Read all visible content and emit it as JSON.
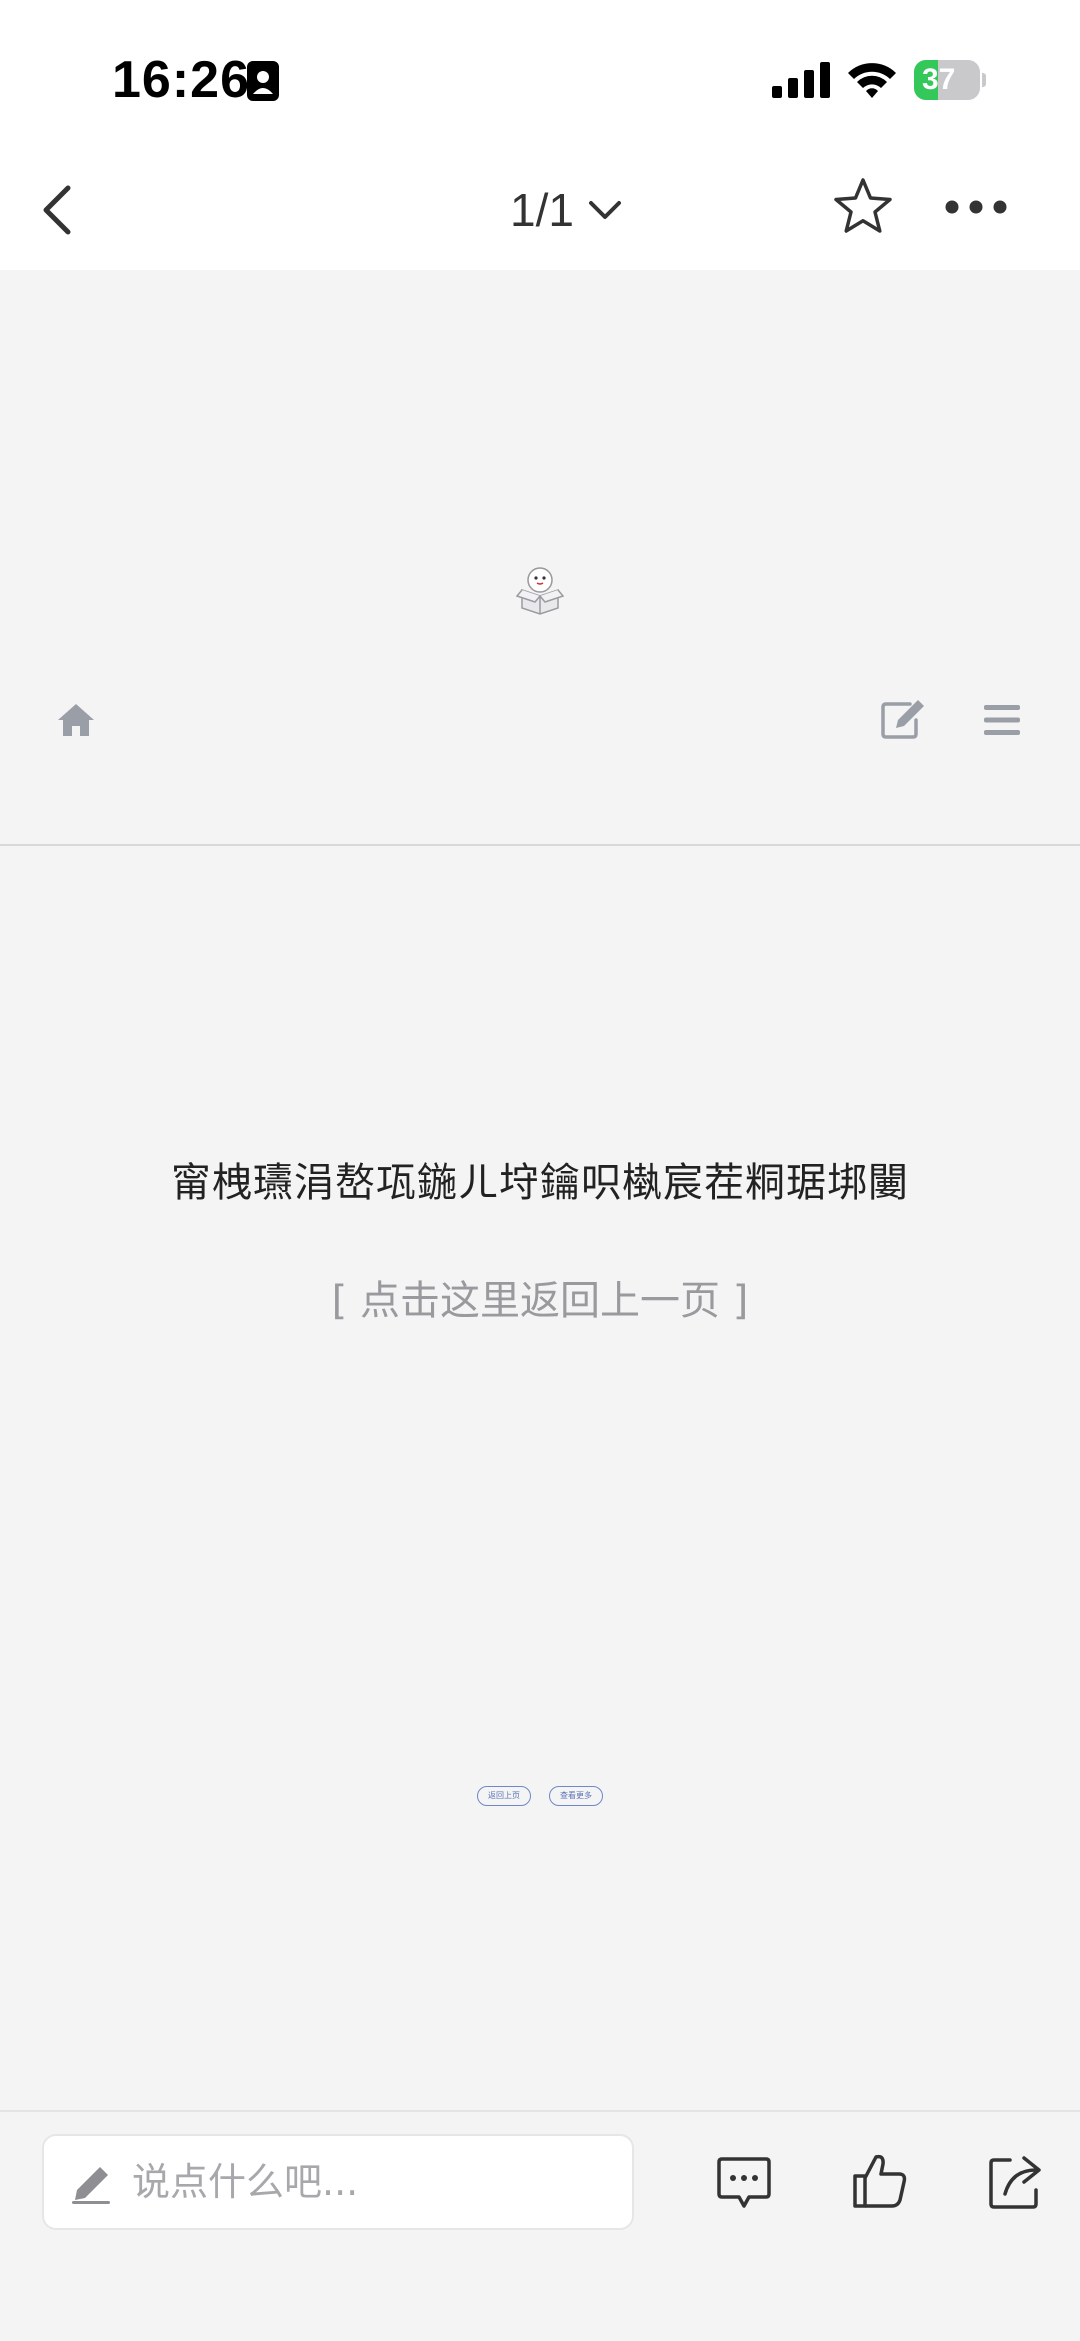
{
  "status_bar": {
    "time": "16:26",
    "battery_level": "37",
    "battery_fraction": 0.37,
    "battery_color": "#34c759"
  },
  "nav": {
    "page_indicator": "1/1",
    "back_icon": "chevron-left-icon",
    "dropdown_icon": "chevron-down-icon",
    "favorite_icon": "star-icon",
    "more_icon": "ellipsis-icon"
  },
  "web": {
    "mascot_icon": "mascot-box-icon",
    "site_icons": [
      "home-icon",
      "edit-icon",
      "menu-icon"
    ],
    "error_message": "甯栧瓙涓嶅瓨鍦ㄦ垨鑰呮槸宸茬粡琚垹闄",
    "back_link": "[ 点击这里返回上一页 ]",
    "mini_buttons": [
      "返回上页",
      "查看更多"
    ],
    "accent_color": "#6f87c9"
  },
  "bottom_bar": {
    "comment_placeholder": "说点什么吧...",
    "icons": [
      "pencil-icon",
      "comments-icon",
      "thumbs-up-icon",
      "share-icon"
    ]
  }
}
